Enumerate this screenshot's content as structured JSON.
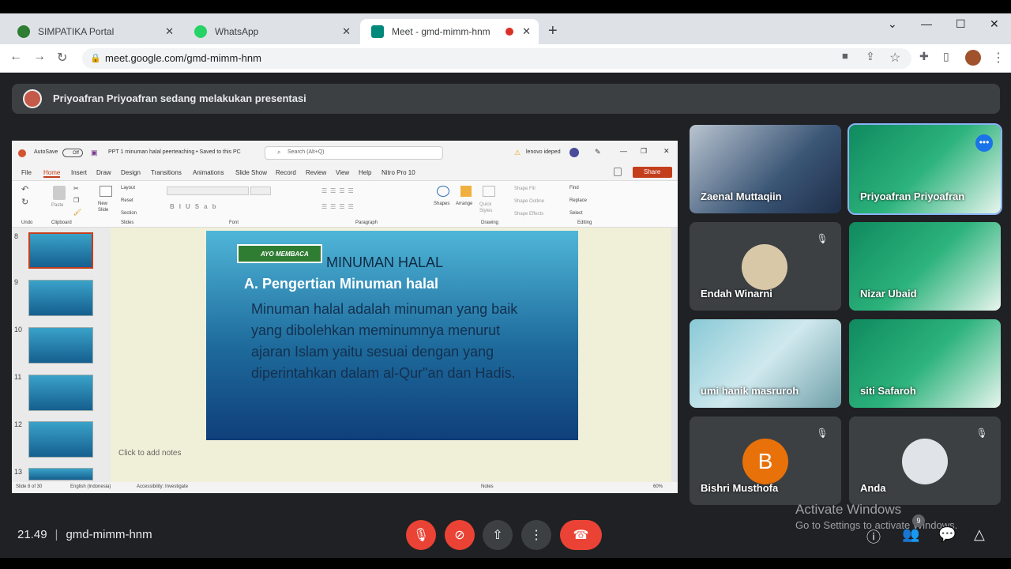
{
  "browser": {
    "tabs": [
      {
        "title": "SIMPATIKA Portal",
        "favicon_color": "#2e7d32"
      },
      {
        "title": "WhatsApp",
        "favicon_color": "#25d366"
      },
      {
        "title": "Meet - gmd-mimm-hnm",
        "favicon_color": "#00897b"
      }
    ],
    "new_tab": "+",
    "url": "meet.google.com/gmd-mimm-hnm"
  },
  "meet": {
    "banner": "Priyoafran Priyoafran sedang melakukan presentasi",
    "participants": [
      {
        "name": "Zaenal Muttaqiin",
        "bg": "#5a6f8a",
        "muted": false
      },
      {
        "name": "Priyoafran Priyoafran",
        "bg": "#1b8a64",
        "muted": false,
        "highlighted": true
      },
      {
        "name": "Endah Winarni",
        "bg": "#3c4043",
        "muted": true
      },
      {
        "name": "Nizar Ubaid",
        "bg": "#1b8a64",
        "muted": false
      },
      {
        "name": "umi hanik masruroh",
        "bg": "#7fb6c9",
        "muted": false
      },
      {
        "name": "siti Safaroh",
        "bg": "#1b8a64",
        "muted": false
      },
      {
        "name": "Bishri Musthofa",
        "bg": "#3c4043",
        "muted": true,
        "avatar_letter": "B",
        "avatar_color": "#e8710a"
      },
      {
        "name": "Anda",
        "bg": "#3c4043",
        "muted": true
      }
    ],
    "time": "21.49",
    "meeting_code": "gmd-mimm-hnm",
    "participant_count": "9",
    "watermark_title": "Activate Windows",
    "watermark_sub": "Go to Settings to activate Windows."
  },
  "powerpoint": {
    "autosave": "AutoSave",
    "autosave_state": "Off",
    "doc_title": "PPT 1 minuman halal peerteaching • Saved to this PC",
    "search_placeholder": "Search (Alt+Q)",
    "user": "lenovo ideped",
    "ribbon_tabs": [
      "File",
      "Home",
      "Insert",
      "Draw",
      "Design",
      "Transitions",
      "Animations",
      "Slide Show",
      "Record",
      "Review",
      "View",
      "Help",
      "Nitro Pro 10"
    ],
    "share": "Share",
    "groups": [
      "Undo",
      "Clipboard",
      "Slides",
      "Font",
      "Paragraph",
      "Drawing",
      "Editing"
    ],
    "ribbon_items": {
      "paste": "Paste",
      "new_slide": "New Slide",
      "layout": "Layout",
      "reset": "Reset",
      "section": "Section",
      "shapes": "Shapes",
      "arrange": "Arrange",
      "quick_styles": "Quick Styles",
      "shape_fill": "Shape Fill",
      "shape_outline": "Shape Outline",
      "shape_effects": "Shape Effects",
      "find": "Find",
      "replace": "Replace",
      "select": "Select"
    },
    "thumb_numbers": [
      "8",
      "9",
      "10",
      "11",
      "12",
      "13"
    ],
    "slide": {
      "badge": "AYO MEMBACA",
      "title": "MINUMAN HALAL",
      "bullet_a": "A. Pengertian Minuman halal",
      "body": "Minuman halal adalah minuman yang baik yang dibolehkan meminumnya menurut ajaran Islam yaitu sesuai dengan yang diperintahkan dalam al-Qur\"an dan Hadis."
    },
    "notes_placeholder": "Click to add notes",
    "status": {
      "slide": "Slide 8 of 30",
      "lang": "English (Indonesia)",
      "access": "Accessibility: Investigate",
      "notes": "Notes",
      "zoom": "60%"
    }
  }
}
